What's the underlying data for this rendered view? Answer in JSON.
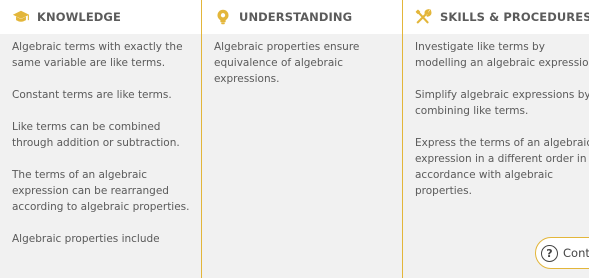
{
  "columns": [
    {
      "title": "KNOWLEDGE",
      "icon": "graduation-cap-icon",
      "items": [
        [
          "Algebraic terms with exactly the",
          "same variable are like terms."
        ],
        [
          "Constant terms are like terms."
        ],
        [
          "Like terms can be combined",
          "through addition or subtraction."
        ],
        [
          "The terms of an algebraic",
          "expression can be rearranged",
          "according to algebraic properties."
        ],
        [
          "Algebraic properties include"
        ]
      ]
    },
    {
      "title": "UNDERSTANDING",
      "icon": "lightbulb-icon",
      "items": [
        [
          "Algebraic properties ensure",
          "equivalence of algebraic",
          "expressions."
        ]
      ]
    },
    {
      "title": "SKILLS & PROCEDURES",
      "icon": "wrench-screwdriver-icon",
      "items": [
        [
          "Investigate like terms by",
          "modelling an algebraic expression."
        ],
        [
          "Simplify algebraic expressions by",
          "combining like terms."
        ],
        [
          "Express the terms of an algebraic",
          "expression in a different order in",
          "accordance with algebraic",
          "properties."
        ]
      ]
    }
  ],
  "contact_button": {
    "label": "Contact",
    "icon": "question-circle-icon"
  },
  "colors": {
    "accent": "#e3b63a",
    "panel_bg": "#f1f1f1",
    "text": "#5a5a5a"
  }
}
